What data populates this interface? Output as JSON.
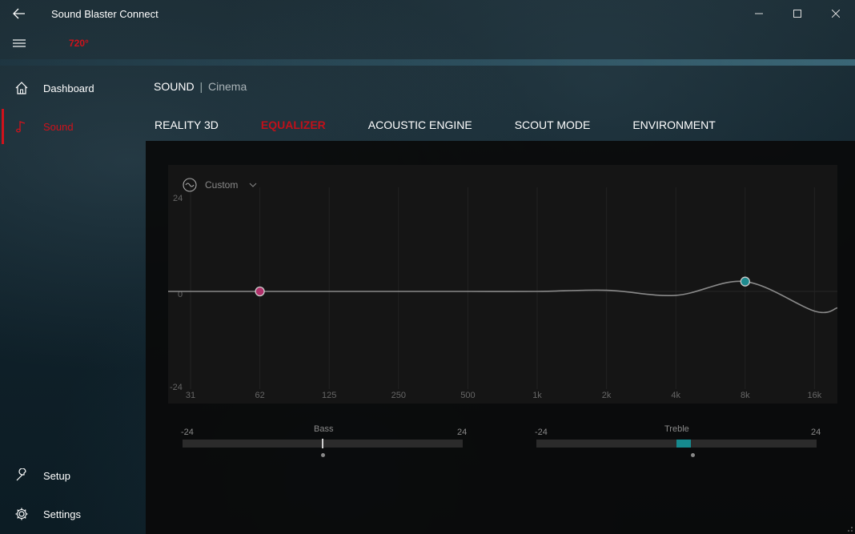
{
  "window": {
    "title": "Sound Blaster Connect",
    "brand_label": "720°"
  },
  "sidebar": {
    "items": [
      {
        "label": "Dashboard",
        "icon": "home-icon",
        "active": false
      },
      {
        "label": "Sound",
        "icon": "music-note-icon",
        "active": true
      }
    ],
    "bottom_items": [
      {
        "label": "Setup",
        "icon": "wrench-icon"
      },
      {
        "label": "Settings",
        "icon": "gear-icon"
      }
    ]
  },
  "breadcrumb": {
    "section": "SOUND",
    "separator": "|",
    "profile": "Cinema"
  },
  "tabs": [
    {
      "label": "REALITY 3D",
      "active": false
    },
    {
      "label": "EQUALIZER",
      "active": true
    },
    {
      "label": "ACOUSTIC ENGINE",
      "active": false
    },
    {
      "label": "SCOUT MODE",
      "active": false
    },
    {
      "label": "ENVIRONMENT",
      "active": false
    }
  ],
  "equalizer": {
    "preset": "Custom",
    "db_labels": {
      "top": "24",
      "mid": "0",
      "bottom": "-24"
    },
    "bands": [
      "31",
      "62",
      "125",
      "250",
      "500",
      "1k",
      "2k",
      "4k",
      "8k",
      "16k"
    ],
    "gains_db": [
      0,
      0,
      0,
      0,
      0,
      0,
      0.3,
      -1,
      2.5,
      -5
    ],
    "handles": [
      {
        "band": "62",
        "color": "#b0306a"
      },
      {
        "band": "8k",
        "color": "#1e8a8e"
      }
    ]
  },
  "bass": {
    "label": "Bass",
    "min": "-24",
    "max": "24",
    "value_db": 0
  },
  "treble": {
    "label": "Treble",
    "min": "-24",
    "max": "24",
    "value_db": 2.5
  },
  "colors": {
    "accent_red": "#d0121b",
    "teal": "#1e8a8e",
    "magenta_handle": "#b0306a"
  }
}
